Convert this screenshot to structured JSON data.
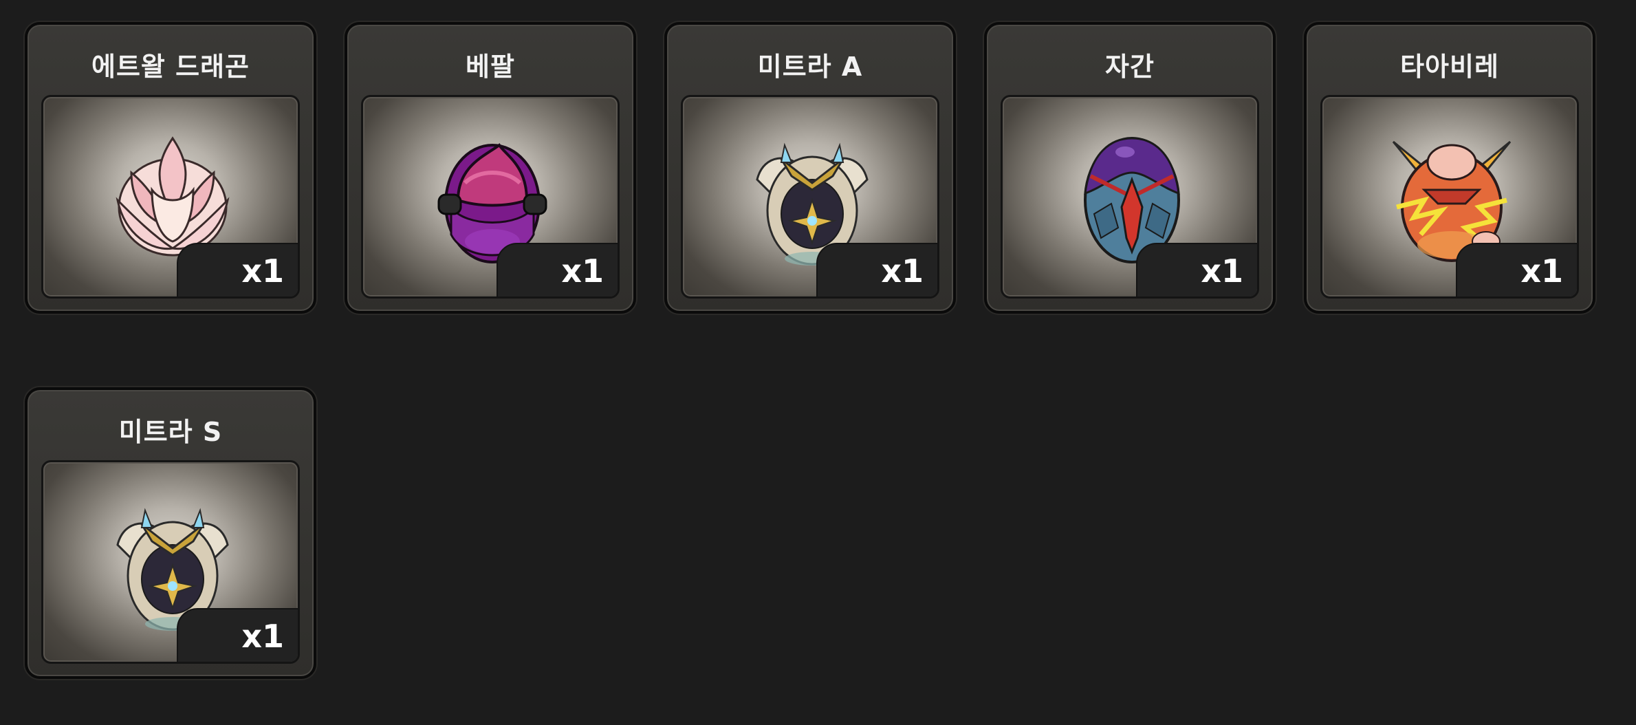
{
  "items": [
    {
      "name": "에트왈 드래곤",
      "quantity": "x1",
      "icon": "lotus-egg-icon"
    },
    {
      "name": "베팔",
      "quantity": "x1",
      "icon": "purple-swirl-egg-icon"
    },
    {
      "name": "미트라 A",
      "quantity": "x1",
      "icon": "mitra-winged-egg-icon"
    },
    {
      "name": "자간",
      "quantity": "x1",
      "icon": "zagan-egg-icon"
    },
    {
      "name": "타아비레",
      "quantity": "x1",
      "icon": "lightning-egg-icon"
    },
    {
      "name": "미트라 S",
      "quantity": "x1",
      "icon": "mitra-winged-egg-icon"
    }
  ],
  "colors": {
    "background": "#1c1c1c",
    "card": "#33322f",
    "badge": "#222222",
    "text": "#f2f2f2"
  }
}
